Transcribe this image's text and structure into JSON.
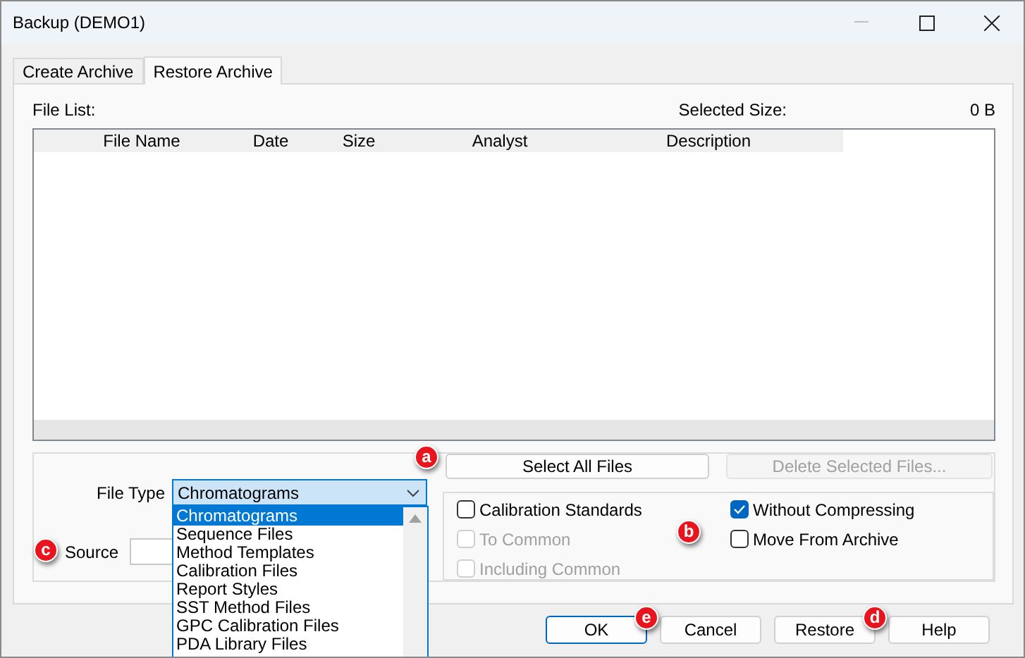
{
  "window": {
    "title": "Backup (DEMO1)"
  },
  "tabs": [
    {
      "label": "Create Archive",
      "selected": false
    },
    {
      "label": "Restore Archive",
      "selected": true
    }
  ],
  "file_list": {
    "label": "File List:",
    "selected_size_label": "Selected Size:",
    "selected_size": "0 B",
    "columns": [
      "File Name",
      "Date",
      "Size",
      "Analyst",
      "Description"
    ]
  },
  "select_all_button": {
    "label": "Select All Files",
    "disabled": false,
    "callout": "a"
  },
  "delete_button": {
    "label": "Delete Selected Files...",
    "disabled": true
  },
  "file_type": {
    "label": "File Type",
    "value": "Chromatograms",
    "open": true,
    "options": [
      {
        "label": "Chromatograms",
        "selected": true
      },
      {
        "label": "Sequence Files",
        "selected": false
      },
      {
        "label": "Method Templates",
        "selected": false
      },
      {
        "label": "Calibration Files",
        "selected": false
      },
      {
        "label": "Report Styles",
        "selected": false
      },
      {
        "label": "SST Method Files",
        "selected": false
      },
      {
        "label": "GPC Calibration Files",
        "selected": false
      },
      {
        "label": "PDA Library Files",
        "selected": false
      }
    ]
  },
  "source": {
    "label": "Source",
    "callout": "c"
  },
  "options_callout": "b",
  "options": [
    {
      "label": "Calibration Standards",
      "checked": false,
      "disabled": false
    },
    {
      "label": "Without Compressing",
      "checked": true,
      "disabled": false
    },
    {
      "label": "To Common",
      "checked": false,
      "disabled": true
    },
    {
      "label": "Move From Archive",
      "checked": false,
      "disabled": false
    },
    {
      "label": "Including Common",
      "checked": false,
      "disabled": true
    }
  ],
  "buttons": [
    {
      "label": "OK",
      "default": true,
      "callout": "e"
    },
    {
      "label": "Cancel",
      "default": false
    },
    {
      "label": "Restore",
      "default": false,
      "callout": "d"
    },
    {
      "label": "Help",
      "default": false
    }
  ]
}
